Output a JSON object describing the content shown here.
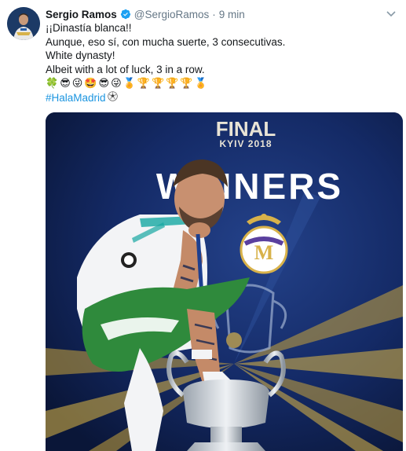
{
  "tweet": {
    "author_name": "Sergio Ramos",
    "handle": "@SergioRamos",
    "separator": "·",
    "time": "9 min",
    "lines": [
      "¡¡Dinastía blanca!!",
      "Aunque, eso sí, con mucha suerte, 3 consecutivas.",
      "White dynasty!",
      "Albeit with a lot of luck, 3 in a row."
    ],
    "emojis": [
      "🍀",
      "😎",
      "😜",
      "🤩",
      "😎",
      "😜",
      "🏅",
      "🏆",
      "🏆",
      "🏆",
      "🏆",
      "🏅"
    ],
    "hashtag": "#HalaMadrid",
    "icons": {
      "avatar": "avatar",
      "verified": "verified-badge-icon",
      "menu": "chevron-down-icon",
      "hashtag_emoji": "soccer-ball-icon"
    },
    "colors": {
      "link": "#1b95e0",
      "verified": "#1da1f2",
      "muted": "#657786"
    }
  },
  "photo": {
    "banner_title": "FINAL",
    "banner_subtitle": "KYIV 2018",
    "winners_text": "WINNERS"
  }
}
